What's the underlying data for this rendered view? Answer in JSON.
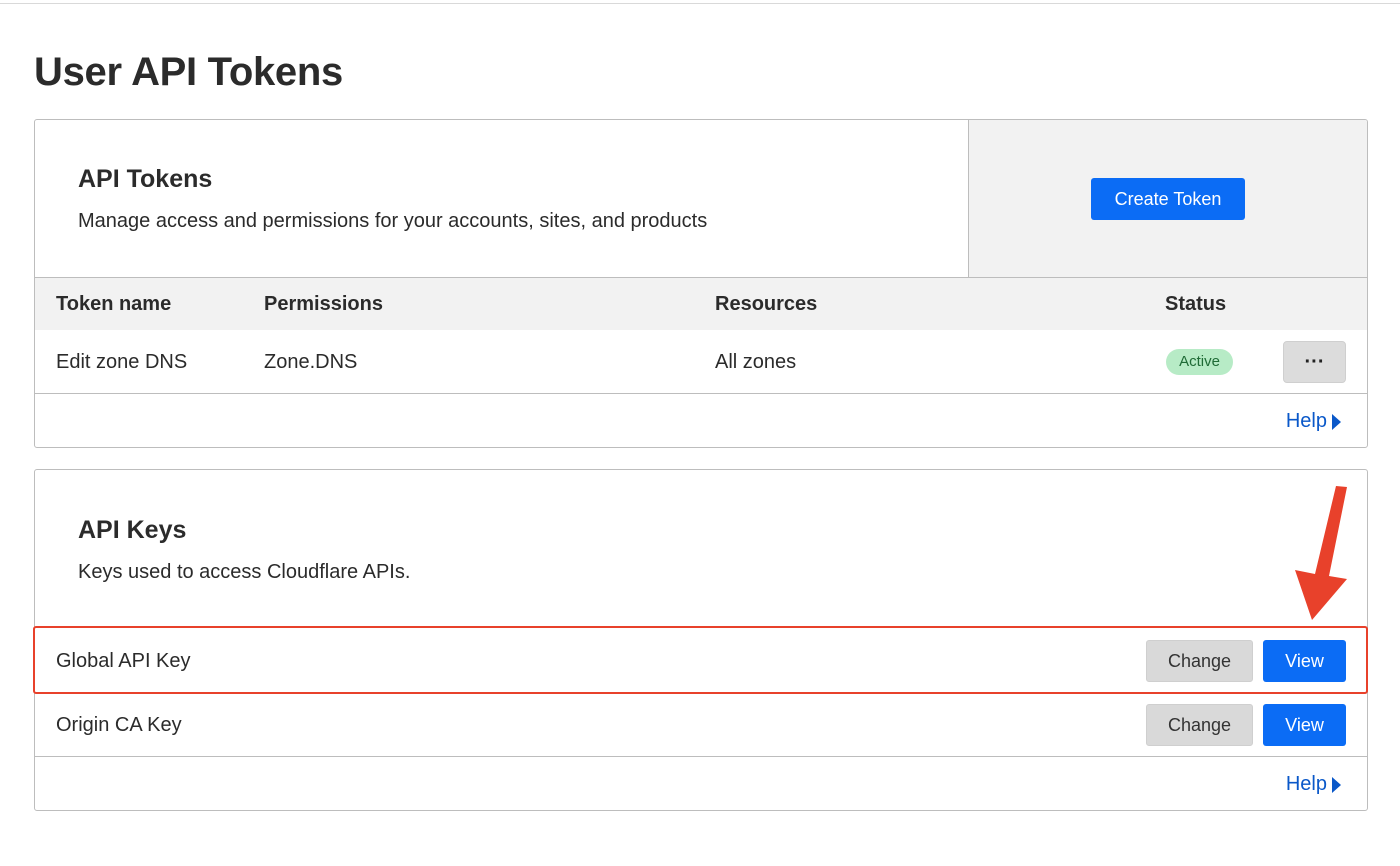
{
  "page": {
    "title": "User API Tokens"
  },
  "tokens": {
    "title": "API Tokens",
    "description": "Manage access and permissions for your accounts, sites, and products",
    "create_label": "Create Token",
    "columns": [
      "Token name",
      "Permissions",
      "Resources",
      "Status"
    ],
    "rows": [
      {
        "name": "Edit zone DNS",
        "permissions": "Zone.DNS",
        "resources": "All zones",
        "status": "Active",
        "menu_label": "···"
      }
    ],
    "help_label": "Help"
  },
  "keys": {
    "title": "API Keys",
    "description": "Keys used to access Cloudflare APIs.",
    "items": [
      {
        "label": "Global API Key",
        "change_label": "Change",
        "view_label": "View"
      },
      {
        "label": "Origin CA Key",
        "change_label": "Change",
        "view_label": "View"
      }
    ],
    "help_label": "Help"
  },
  "annotation": {
    "color": "#e8412b"
  },
  "colors": {
    "primary": "#0b6cf5",
    "link": "#0a58c9",
    "active_badge": "#b7ebc6"
  }
}
